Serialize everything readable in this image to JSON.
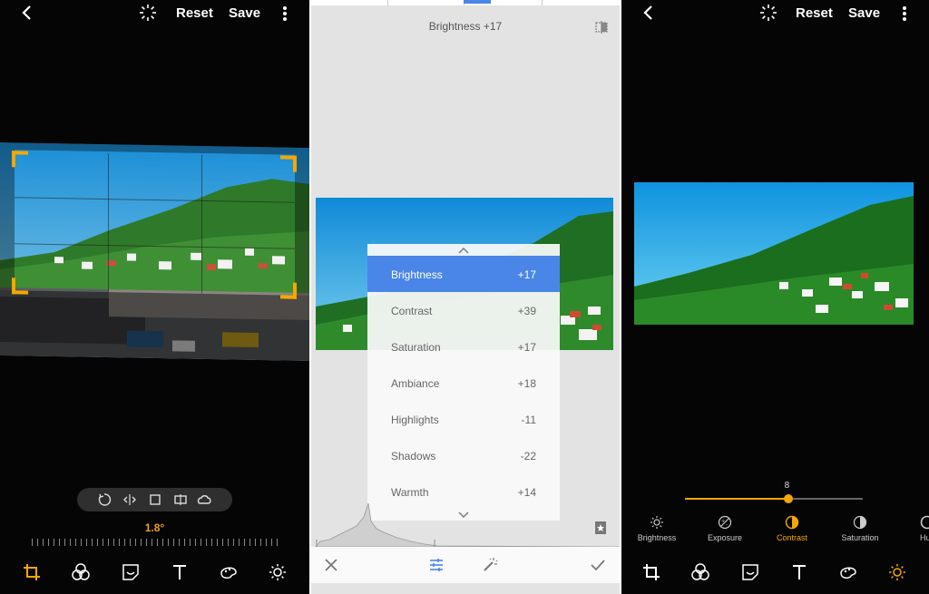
{
  "left_panel": {
    "topbar": {
      "reset_label": "Reset",
      "save_label": "Save"
    },
    "angle_text": "1.8°",
    "crop_tools": [
      "rotate-icon",
      "flip-icon",
      "aspect-ratio-icon",
      "free-crop-icon",
      "lasso-icon"
    ],
    "bottom_nav": [
      "crop-icon",
      "filters-icon",
      "sticker-icon",
      "text-icon",
      "brush-icon",
      "adjust-icon"
    ],
    "active_tool": "crop-icon"
  },
  "middle_panel": {
    "status_title": "Brightness +17",
    "menu": [
      {
        "label": "Brightness",
        "value": "+17",
        "selected": true
      },
      {
        "label": "Contrast",
        "value": "+39"
      },
      {
        "label": "Saturation",
        "value": "+17"
      },
      {
        "label": "Ambiance",
        "value": "+18"
      },
      {
        "label": "Highlights",
        "value": "-11"
      },
      {
        "label": "Shadows",
        "value": "-22"
      },
      {
        "label": "Warmth",
        "value": "+14"
      }
    ],
    "bottom_bar": [
      "close-icon",
      "tune-icon",
      "magic-wand-icon",
      "check-icon"
    ],
    "accent": "#4a86e8"
  },
  "right_panel": {
    "topbar": {
      "reset_label": "Reset",
      "save_label": "Save"
    },
    "slider_value": "8",
    "slider_fraction": 0.58,
    "adjustments": [
      {
        "label": "Brightness",
        "icon": "sun-icon"
      },
      {
        "label": "Exposure",
        "icon": "exposure-icon"
      },
      {
        "label": "Contrast",
        "icon": "contrast-icon",
        "active": true
      },
      {
        "label": "Saturation",
        "icon": "saturation-icon"
      },
      {
        "label": "Hu",
        "icon": "hue-icon"
      }
    ],
    "bottom_nav": [
      "crop-icon",
      "filters-icon",
      "sticker-icon",
      "text-icon",
      "brush-icon",
      "adjust-icon"
    ],
    "active_tool": "adjust-icon",
    "accent": "#f5a800"
  }
}
